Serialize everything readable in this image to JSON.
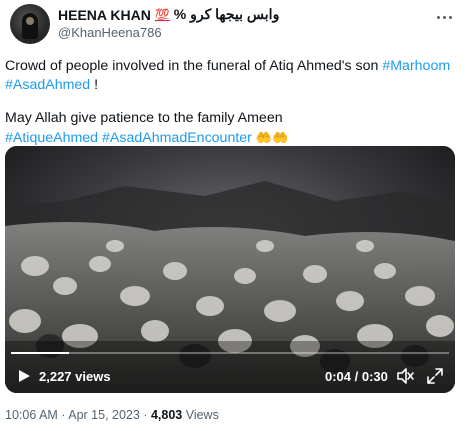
{
  "author": {
    "name": "HEENA KHAN",
    "badge": "💯",
    "name_suffix": "% وابس بیجھا کرو",
    "handle": "@KhanHeena786"
  },
  "tweet": {
    "line1_text": "Crowd of people involved in the funeral of Atiq Ahmed's son ",
    "line1_tag1": "#Marhoom",
    "line2_tag": "#AsadAhmed",
    "line2_after": " !",
    "line3_text": "May Allah give patience to the family Ameen",
    "line4_tag1": "#AtiqueAhmed",
    "line4_tag2": "#AsadAhmadEncounter",
    "line4_emoji": "🤲🤲"
  },
  "video": {
    "views": "2,227 views",
    "timecode": "0:04 / 0:30",
    "progress": 0.133,
    "icons": {
      "play": "play-icon",
      "volume": "volume-icon",
      "fullscreen": "fullscreen-icon"
    }
  },
  "meta": {
    "time": "10:06 AM",
    "separator": " · ",
    "date": "Apr 15, 2023",
    "separator2": " · ",
    "views_count": "4,803",
    "views_label": " Views"
  },
  "colors": {
    "link": "#1d9bf0",
    "text": "#0f1419",
    "muted": "#536471"
  }
}
